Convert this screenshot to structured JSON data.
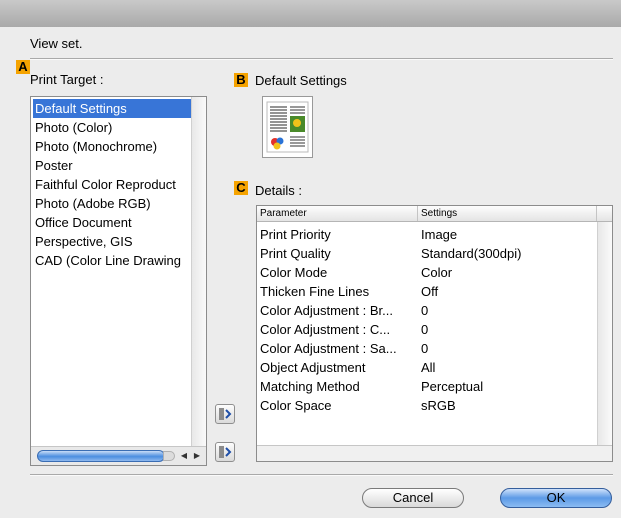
{
  "dialog": {
    "heading": "View set."
  },
  "sections": {
    "a_tag": "A",
    "b_tag": "B",
    "c_tag": "C",
    "print_target_label": "Print Target :",
    "default_settings_label": "Default Settings",
    "details_label": "Details :"
  },
  "print_targets": [
    {
      "label": "Default Settings",
      "selected": true
    },
    {
      "label": "Photo (Color)",
      "selected": false
    },
    {
      "label": "Photo (Monochrome)",
      "selected": false
    },
    {
      "label": "Poster",
      "selected": false
    },
    {
      "label": "Faithful Color Reproduct",
      "selected": false
    },
    {
      "label": "Photo (Adobe RGB)",
      "selected": false
    },
    {
      "label": "Office Document",
      "selected": false
    },
    {
      "label": "Perspective, GIS",
      "selected": false
    },
    {
      "label": "CAD (Color Line Drawing",
      "selected": false
    }
  ],
  "details_table": {
    "headers": [
      "Parameter",
      "Settings"
    ],
    "rows": [
      [
        "Print Priority",
        "Image"
      ],
      [
        "Print Quality",
        "Standard(300dpi)"
      ],
      [
        "Color Mode",
        "Color"
      ],
      [
        "Thicken Fine Lines",
        "Off"
      ],
      [
        "Color Adjustment : Br...",
        "0"
      ],
      [
        "Color Adjustment : C...",
        "0"
      ],
      [
        "Color Adjustment : Sa...",
        "0"
      ],
      [
        "Object Adjustment",
        "All"
      ],
      [
        "Matching Method",
        "Perceptual"
      ],
      [
        "Color Space",
        "sRGB"
      ]
    ]
  },
  "buttons": {
    "cancel": "Cancel",
    "ok": "OK"
  },
  "colors": {
    "tag": "#f5a300",
    "selection": "#3875d7",
    "ok_button": "#5c9ae6"
  }
}
